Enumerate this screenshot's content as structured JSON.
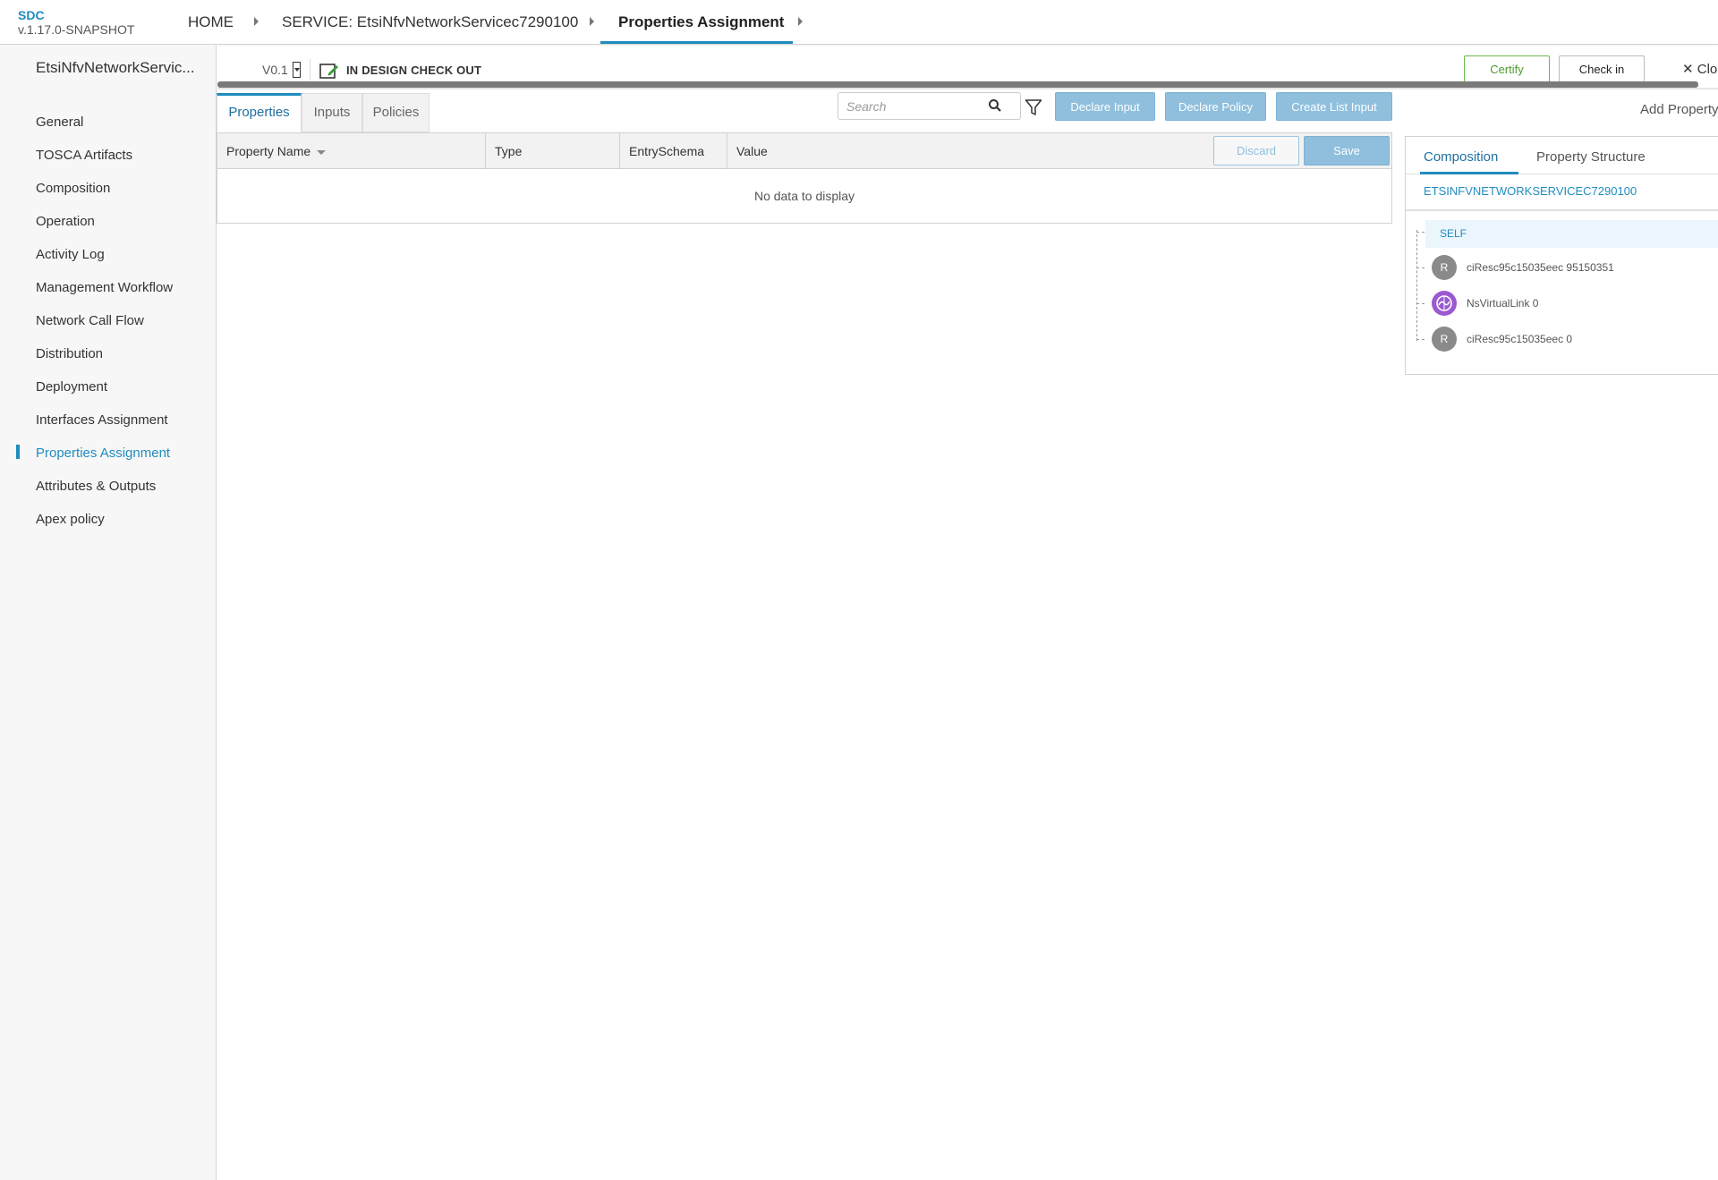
{
  "app": {
    "name": "SDC",
    "version": "v.1.17.0-SNAPSHOT"
  },
  "breadcrumb": {
    "home": "HOME",
    "service": "SERVICE: EtsiNfvNetworkServicec7290100",
    "current": "Properties Assignment"
  },
  "sidebar": {
    "title": "EtsiNfvNetworkServic...",
    "items": [
      {
        "label": "General"
      },
      {
        "label": "TOSCA Artifacts"
      },
      {
        "label": "Composition"
      },
      {
        "label": "Operation"
      },
      {
        "label": "Activity Log"
      },
      {
        "label": "Management Workflow"
      },
      {
        "label": "Network Call Flow"
      },
      {
        "label": "Distribution"
      },
      {
        "label": "Deployment"
      },
      {
        "label": "Interfaces Assignment"
      },
      {
        "label": "Properties Assignment",
        "active": true
      },
      {
        "label": "Attributes & Outputs"
      },
      {
        "label": "Apex policy"
      }
    ]
  },
  "header": {
    "version": "V0.1",
    "status": "IN DESIGN CHECK OUT",
    "certify_label": "Certify",
    "checkin_label": "Check in",
    "close_label": "Clo"
  },
  "tabs": [
    {
      "label": "Properties",
      "active": true
    },
    {
      "label": "Inputs"
    },
    {
      "label": "Policies"
    }
  ],
  "search": {
    "placeholder": "Search",
    "value": ""
  },
  "actions": {
    "declare_input": "Declare Input",
    "declare_policy": "Declare Policy",
    "create_list_input": "Create List Input"
  },
  "table": {
    "columns": [
      "Property Name",
      "Type",
      "EntrySchema",
      "Value"
    ],
    "discard_label": "Discard",
    "save_label": "Save",
    "empty_message": "No data to display",
    "rows": []
  },
  "right_panel": {
    "title": "Add Property",
    "tabs": [
      "Composition",
      "Property Structure"
    ],
    "service_name": "ETSINFVNETWORKSERVICEC7290100",
    "tree": {
      "root": "SELF",
      "nodes": [
        {
          "icon": "R",
          "label": "ciResc95c15035eec 95150351",
          "kind": "resource"
        },
        {
          "icon": "network-icon",
          "label": "NsVirtualLink 0",
          "kind": "virtual-link"
        },
        {
          "icon": "R",
          "label": "ciResc95c15035eec 0",
          "kind": "resource"
        }
      ]
    }
  },
  "colors": {
    "accent": "#1f8cbf",
    "certify": "#6ab74e",
    "disabled_button": "#8fbfdd",
    "virtual_link": "#9b59d0",
    "resource_icon": "#8a8a8a"
  }
}
